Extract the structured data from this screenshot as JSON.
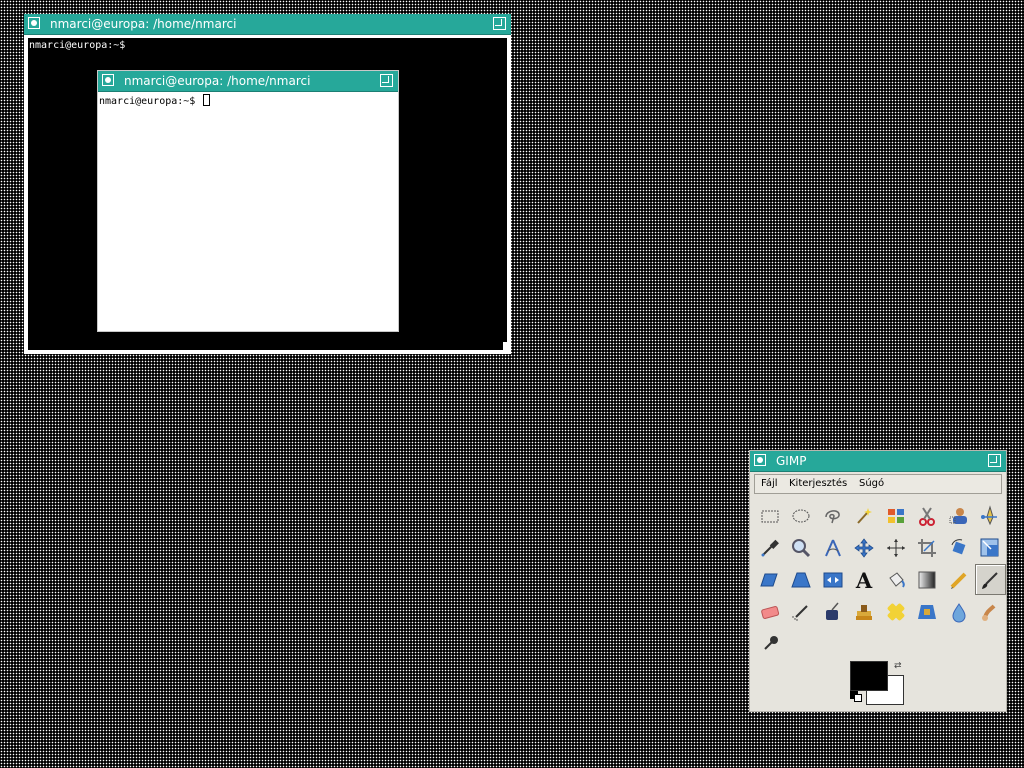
{
  "terminal1": {
    "title": "nmarci@europa: /home/nmarci",
    "prompt": "nmarci@europa:~$"
  },
  "terminal2": {
    "title": "nmarci@europa: /home/nmarci",
    "prompt": "nmarci@europa:~$ "
  },
  "gimp": {
    "title": "GIMP",
    "menu": {
      "file": "Fájl",
      "extensions": "Kiterjesztés",
      "help": "Súgó"
    },
    "tools": [
      "rect-select-icon",
      "ellipse-select-icon",
      "free-select-icon",
      "fuzzy-select-icon",
      "color-select-icon",
      "scissors-icon",
      "foreground-select-icon",
      "paths-icon",
      "color-picker-icon",
      "zoom-icon",
      "measure-icon",
      "move-icon",
      "align-icon",
      "crop-icon",
      "rotate-icon",
      "scale-icon",
      "shear-icon",
      "perspective-icon",
      "flip-icon",
      "text-icon",
      "bucket-fill-icon",
      "blend-icon",
      "pencil-icon",
      "paintbrush-icon",
      "eraser-icon",
      "airbrush-icon",
      "ink-icon",
      "clone-icon",
      "heal-icon",
      "perspective-clone-icon",
      "blur-icon",
      "smudge-icon",
      "dodge-burn-icon"
    ],
    "active_tool": "paintbrush-icon",
    "foreground_color": "#000000",
    "background_color": "#ffffff"
  },
  "colors": {
    "titlebar": "#26a89a",
    "terminal1_bg": "#000000",
    "terminal2_bg": "#ffffff",
    "gimp_bg": "#e6e4dd"
  }
}
